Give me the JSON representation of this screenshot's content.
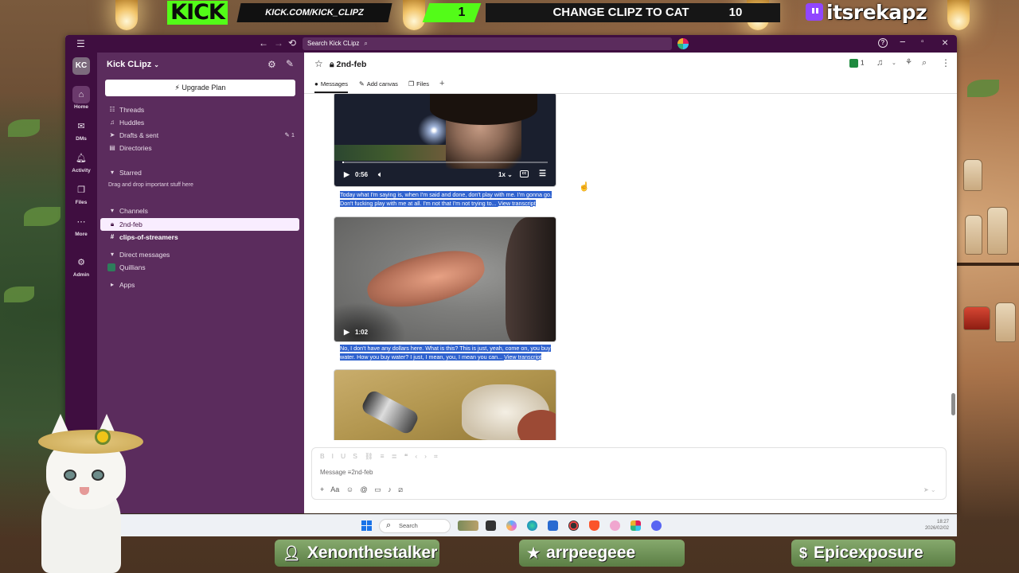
{
  "overlay": {
    "kick_logo": "KICK",
    "kick_url": "KICK.COM/KICK_CLIPZ",
    "kick_count": "1",
    "goal_text": "CHANGE CLIPZ TO CAT",
    "goal_number": "10",
    "twitch_name": "itsrekapz",
    "bottom_names": [
      "Xenonthestalker",
      "arrpeegeee",
      "Epicexposure"
    ]
  },
  "window": {
    "search_placeholder": "Search Kick CLipz"
  },
  "rail": {
    "workspace_initials": "KC",
    "items": [
      {
        "label": "Home",
        "icon": "home-icon"
      },
      {
        "label": "DMs",
        "icon": "dms-icon"
      },
      {
        "label": "Activity",
        "icon": "bell-icon"
      },
      {
        "label": "Files",
        "icon": "files-icon"
      },
      {
        "label": "More",
        "icon": "more-icon"
      },
      {
        "label": "Admin",
        "icon": "gear-icon"
      }
    ]
  },
  "sidebar": {
    "workspace_name": "Kick CLipz",
    "upgrade_label": "Upgrade Plan",
    "threads": "Threads",
    "huddles": "Huddles",
    "drafts": "Drafts & sent",
    "drafts_badge": "1",
    "directories": "Directories",
    "starred": "Starred",
    "starred_hint": "Drag and drop important stuff here",
    "channels_header": "Channels",
    "channels": [
      "2nd-feb",
      "clips-of-streamers"
    ],
    "dm_header": "Direct messages",
    "dms": [
      "Quillians"
    ],
    "apps": "Apps"
  },
  "channel": {
    "name": "2nd-feb",
    "member_count": "1",
    "tabs": [
      "Messages",
      "Add canvas",
      "Files"
    ]
  },
  "messages": [
    {
      "duration": "0:56",
      "speed": "1x",
      "transcript": "Today what I'm saying is, when I'm said and done, don't play with me. I'm gonna go. Don't fucking play with me at all. I'm not that I'm not trying to...",
      "transcript_link": "View transcript"
    },
    {
      "duration": "1:02",
      "transcript": "No, I don't have any dollars here. What is this? This is just, yeah, come on, you buy water. How you buy water? I just, I mean, you, I mean you can...",
      "transcript_link": "View transcript"
    }
  ],
  "composer": {
    "placeholder": "Message ≡2nd-feb"
  },
  "taskbar": {
    "search_label": "Search",
    "time": "18:27",
    "date": "2026/02/02"
  }
}
